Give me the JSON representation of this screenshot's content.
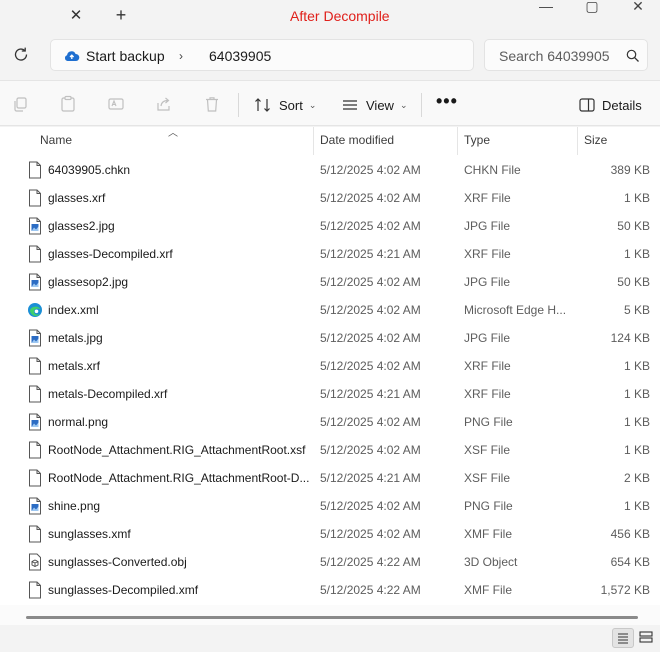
{
  "window": {
    "title": "After Decompile",
    "new_tab": "+",
    "close_tab": "✕",
    "minimize": "—",
    "maximize": "▢",
    "close": "✕"
  },
  "address": {
    "crumbs": [
      "Start backup",
      "64039905"
    ],
    "separator": "›",
    "search_placeholder": "Search 64039905"
  },
  "toolbar": {
    "sort_label": "Sort",
    "view_label": "View",
    "more_label": "•••",
    "details_label": "Details"
  },
  "columns": {
    "name": "Name",
    "date": "Date modified",
    "type": "Type",
    "size": "Size"
  },
  "files": [
    {
      "icon": "file",
      "name": "64039905.chkn",
      "date": "5/12/2025 4:02 AM",
      "type": "CHKN File",
      "size": "389 KB"
    },
    {
      "icon": "file",
      "name": "glasses.xrf",
      "date": "5/12/2025 4:02 AM",
      "type": "XRF File",
      "size": "1 KB"
    },
    {
      "icon": "image",
      "name": "glasses2.jpg",
      "date": "5/12/2025 4:02 AM",
      "type": "JPG File",
      "size": "50 KB"
    },
    {
      "icon": "file",
      "name": "glasses-Decompiled.xrf",
      "date": "5/12/2025 4:21 AM",
      "type": "XRF File",
      "size": "1 KB"
    },
    {
      "icon": "image",
      "name": "glassesop2.jpg",
      "date": "5/12/2025 4:02 AM",
      "type": "JPG File",
      "size": "50 KB"
    },
    {
      "icon": "edge",
      "name": "index.xml",
      "date": "5/12/2025 4:02 AM",
      "type": "Microsoft Edge H...",
      "size": "5 KB"
    },
    {
      "icon": "image",
      "name": "metals.jpg",
      "date": "5/12/2025 4:02 AM",
      "type": "JPG File",
      "size": "124 KB"
    },
    {
      "icon": "file",
      "name": "metals.xrf",
      "date": "5/12/2025 4:02 AM",
      "type": "XRF File",
      "size": "1 KB"
    },
    {
      "icon": "file",
      "name": "metals-Decompiled.xrf",
      "date": "5/12/2025 4:21 AM",
      "type": "XRF File",
      "size": "1 KB"
    },
    {
      "icon": "image",
      "name": "normal.png",
      "date": "5/12/2025 4:02 AM",
      "type": "PNG File",
      "size": "1 KB"
    },
    {
      "icon": "file",
      "name": "RootNode_Attachment.RIG_AttachmentRoot.xsf",
      "date": "5/12/2025 4:02 AM",
      "type": "XSF File",
      "size": "1 KB"
    },
    {
      "icon": "file",
      "name": "RootNode_Attachment.RIG_AttachmentRoot-D...",
      "date": "5/12/2025 4:21 AM",
      "type": "XSF File",
      "size": "2 KB"
    },
    {
      "icon": "image",
      "name": "shine.png",
      "date": "5/12/2025 4:02 AM",
      "type": "PNG File",
      "size": "1 KB"
    },
    {
      "icon": "file",
      "name": "sunglasses.xmf",
      "date": "5/12/2025 4:02 AM",
      "type": "XMF File",
      "size": "456 KB"
    },
    {
      "icon": "object3d",
      "name": "sunglasses-Converted.obj",
      "date": "5/12/2025 4:22 AM",
      "type": "3D Object",
      "size": "654 KB"
    },
    {
      "icon": "file",
      "name": "sunglasses-Decompiled.xmf",
      "date": "5/12/2025 4:22 AM",
      "type": "XMF File",
      "size": "1,572 KB"
    }
  ],
  "colors": {
    "title_red": "#e0201b",
    "image_blue": "#2b6cc4"
  }
}
